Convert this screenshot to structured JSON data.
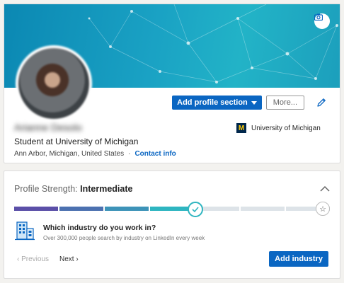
{
  "profile": {
    "name": "Arianne Desolo",
    "headline": "Student at University of Michigan",
    "location": "Ann Arbor, Michigan, United States",
    "separator": "·",
    "contact_label": "Contact info",
    "school": {
      "name": "University of Michigan",
      "logo_letter": "M"
    },
    "banner_icon": "camera-icon",
    "actions": {
      "add_section_label": "Add profile section",
      "more_label": "More...",
      "edit_icon": "pencil-icon"
    }
  },
  "strength": {
    "label": "Profile Strength:",
    "level": "Intermediate",
    "levels_total": 7,
    "levels_completed": 4,
    "question": "Which industry do you work in?",
    "subtext": "Over 300,000 people search by industry on LinkedIn every week",
    "prev_label": "‹  Previous",
    "next_label": "Next  ›",
    "cta_label": "Add industry"
  },
  "colors": {
    "accent": "#0a66c2",
    "meter_start": "#5b4fa8",
    "meter_end": "#2eb5c0",
    "meter_empty": "#dde3e8"
  }
}
